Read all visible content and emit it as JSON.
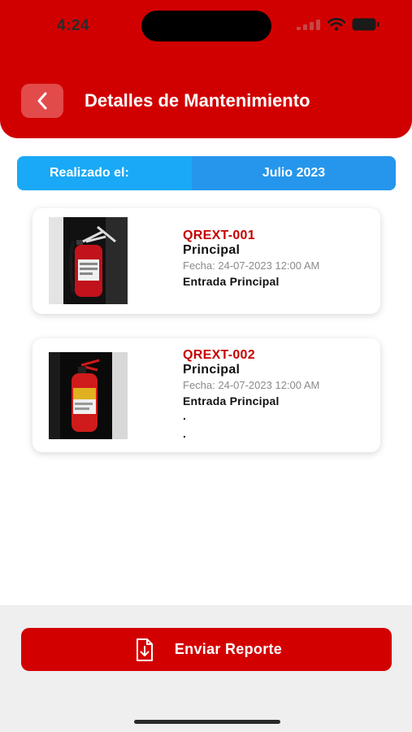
{
  "status_bar": {
    "time": "4:24"
  },
  "header": {
    "title": "Detalles de Mantenimiento",
    "back_icon": "chevron-left-icon"
  },
  "filter": {
    "label": "Realizado el:",
    "value": "Julio 2023"
  },
  "records": [
    {
      "code": "QREXT-001",
      "area": "Principal",
      "date": "Fecha: 24-07-2023 12:00 AM",
      "location": "Entrada Principal",
      "notes": []
    },
    {
      "code": "QREXT-002",
      "area": "Principal",
      "date": "Fecha: 24-07-2023 12:00 AM",
      "location": "Entrada Principal",
      "notes": [
        ".",
        "."
      ]
    }
  ],
  "footer": {
    "button_label": "Enviar Reporte",
    "button_icon": "download-document-icon"
  },
  "colors": {
    "brand_red": "#d10000",
    "filter_blue": "#19a9f6",
    "code_red": "#c70000"
  }
}
